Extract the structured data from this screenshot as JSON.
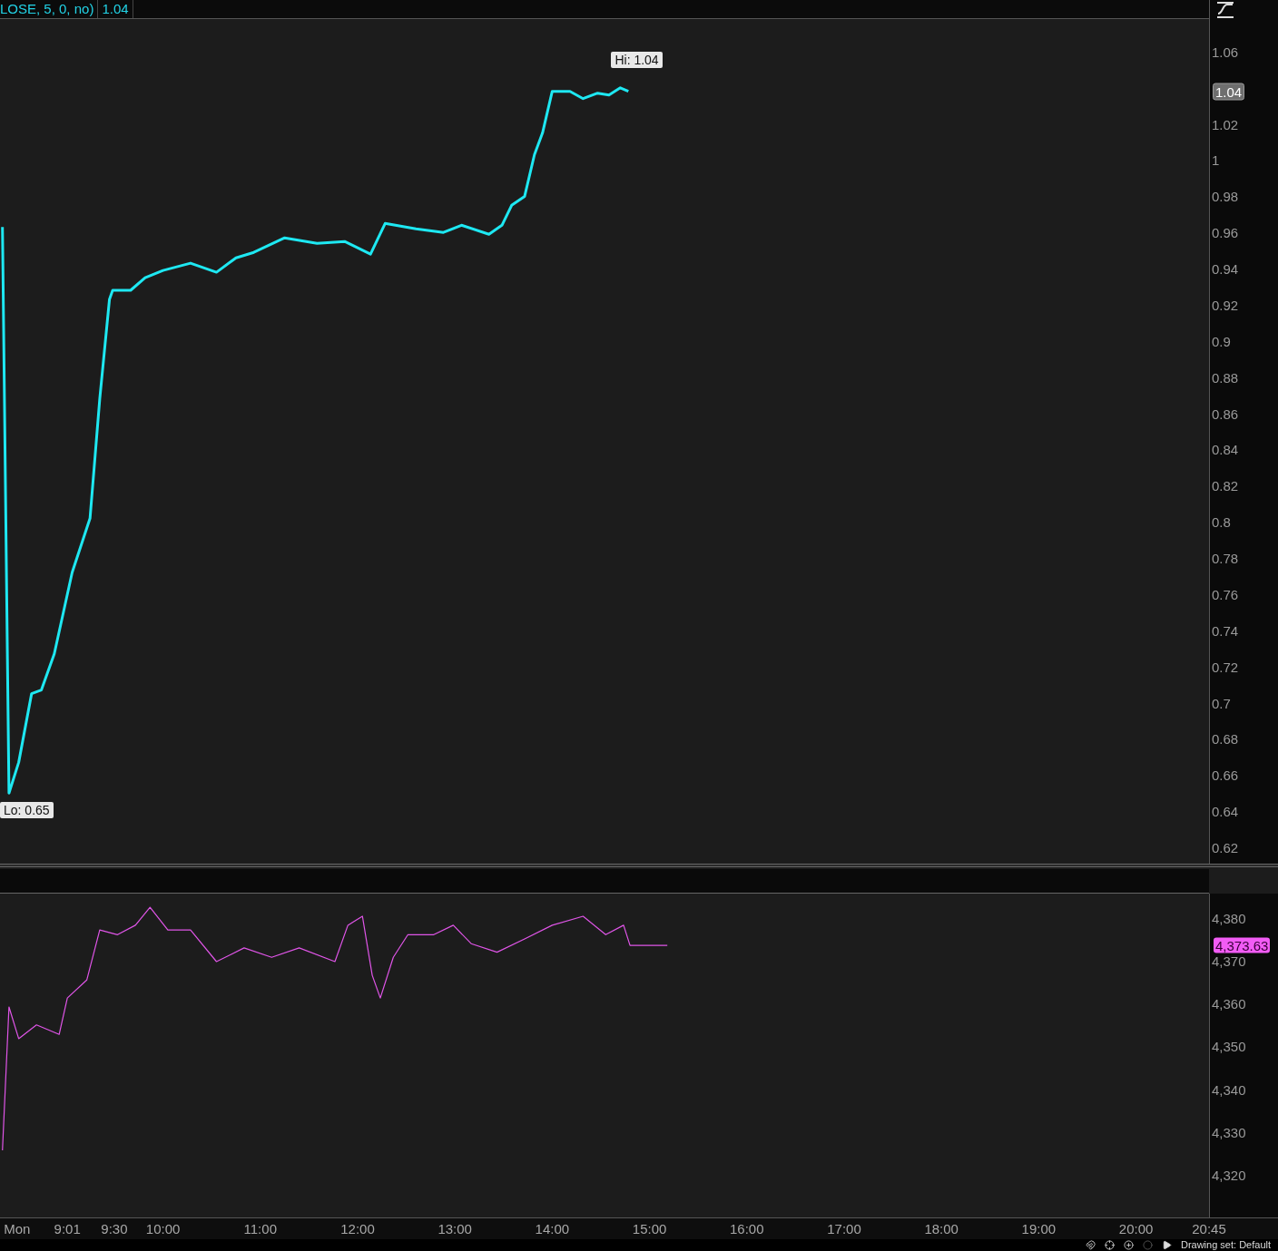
{
  "header": {
    "study_label": "LOSE, 5, 0, no)",
    "study_value": "1.04"
  },
  "price_chart": {
    "current_price": "1.04",
    "chart_data": {
      "type": "line",
      "x": [
        8.35,
        8.417,
        8.517,
        8.65,
        8.75,
        8.883,
        9.067,
        9.25,
        9.35,
        9.45,
        9.483,
        9.667,
        9.817,
        10,
        10.283,
        10.55,
        10.75,
        10.933,
        11.25,
        11.583,
        11.867,
        12.133,
        12.283,
        12.6,
        12.883,
        13.067,
        13.35,
        13.483,
        13.583,
        13.717,
        13.817,
        13.9,
        14,
        14.183,
        14.317,
        14.467,
        14.583,
        14.7,
        14.783
      ],
      "series": [
        {
          "color": "#1ee8f2",
          "values": [
            0.963,
            0.65,
            0.667,
            0.705,
            0.707,
            0.727,
            0.772,
            0.802,
            0.868,
            0.923,
            0.928,
            0.928,
            0.935,
            0.939,
            0.943,
            0.938,
            0.946,
            0.949,
            0.957,
            0.954,
            0.955,
            0.948,
            0.965,
            0.962,
            0.96,
            0.964,
            0.959,
            0.964,
            0.975,
            0.98,
            1.003,
            1.015,
            1.038,
            1.038,
            1.034,
            1.037,
            1.036,
            1.04,
            1.038
          ]
        }
      ],
      "xlim": [
        8.325,
        20.75
      ],
      "ylim": [
        0.611,
        1.078
      ],
      "yticks": [
        {
          "value": 1.06,
          "label": "1.06"
        },
        {
          "value": 1.02,
          "label": "1.02"
        },
        {
          "value": 1,
          "label": "1"
        },
        {
          "value": 0.98,
          "label": "0.98"
        },
        {
          "value": 0.96,
          "label": "0.96"
        },
        {
          "value": 0.94,
          "label": "0.94"
        },
        {
          "value": 0.92,
          "label": "0.92"
        },
        {
          "value": 0.9,
          "label": "0.9"
        },
        {
          "value": 0.88,
          "label": "0.88"
        },
        {
          "value": 0.86,
          "label": "0.86"
        },
        {
          "value": 0.84,
          "label": "0.84"
        },
        {
          "value": 0.82,
          "label": "0.82"
        },
        {
          "value": 0.8,
          "label": "0.8"
        },
        {
          "value": 0.78,
          "label": "0.78"
        },
        {
          "value": 0.76,
          "label": "0.76"
        },
        {
          "value": 0.74,
          "label": "0.74"
        },
        {
          "value": 0.72,
          "label": "0.72"
        },
        {
          "value": 0.7,
          "label": "0.7"
        },
        {
          "value": 0.68,
          "label": "0.68"
        },
        {
          "value": 0.66,
          "label": "0.66"
        },
        {
          "value": 0.64,
          "label": "0.64"
        },
        {
          "value": 0.62,
          "label": "0.62"
        }
      ],
      "annotations": [
        {
          "text": "Hi: 1.04",
          "x": 14.7,
          "y": 1.04
        },
        {
          "text": "Lo: 0.65",
          "x": 8.417,
          "y": 0.65
        }
      ]
    }
  },
  "index_chart": {
    "current_price": "4,373.63",
    "chart_data": {
      "type": "line",
      "x": [
        8.35,
        8.417,
        8.517,
        8.7,
        8.933,
        9.017,
        9.217,
        9.35,
        9.533,
        9.717,
        9.867,
        10.05,
        10.283,
        10.55,
        10.833,
        11.117,
        11.4,
        11.767,
        11.9,
        12.05,
        12.15,
        12.233,
        12.367,
        12.517,
        12.783,
        12.983,
        13.167,
        13.433,
        13.717,
        14,
        14.317,
        14.55,
        14.733,
        14.8,
        15.183
      ],
      "series": [
        {
          "color": "#e055e8",
          "values": [
            4325.7,
            4359.2,
            4351.8,
            4355,
            4352.8,
            4361.3,
            4365.5,
            4377.2,
            4376.1,
            4378.3,
            4382.5,
            4377.2,
            4377.2,
            4369.8,
            4373,
            4370.8,
            4373,
            4369.8,
            4378.3,
            4380.4,
            4366.6,
            4361.3,
            4370.8,
            4376.1,
            4376.1,
            4378.3,
            4374,
            4372,
            4375.1,
            4378.3,
            4380.4,
            4376.1,
            4378.3,
            4373.6,
            4373.6
          ]
        }
      ],
      "xlim": [
        8.325,
        20.75
      ],
      "ylim": [
        4310,
        4385.7
      ],
      "yticks": [
        {
          "value": 4380,
          "label": "4,380"
        },
        {
          "value": 4370,
          "label": "4,370"
        },
        {
          "value": 4360,
          "label": "4,360"
        },
        {
          "value": 4350,
          "label": "4,350"
        },
        {
          "value": 4340,
          "label": "4,340"
        },
        {
          "value": 4330,
          "label": "4,330"
        },
        {
          "value": 4320,
          "label": "4,320"
        }
      ],
      "xticks": [
        {
          "value": 8.5,
          "label": "Mon"
        },
        {
          "value": 9.017,
          "label": "9:01"
        },
        {
          "value": 9.5,
          "label": "9:30"
        },
        {
          "value": 10,
          "label": "10:00"
        },
        {
          "value": 11,
          "label": "11:00"
        },
        {
          "value": 12,
          "label": "12:00"
        },
        {
          "value": 13,
          "label": "13:00"
        },
        {
          "value": 14,
          "label": "14:00"
        },
        {
          "value": 15,
          "label": "15:00"
        },
        {
          "value": 16,
          "label": "16:00"
        },
        {
          "value": 17,
          "label": "17:00"
        },
        {
          "value": 18,
          "label": "18:00"
        },
        {
          "value": 19,
          "label": "19:00"
        },
        {
          "value": 20,
          "label": "20:00"
        },
        {
          "value": 20.75,
          "label": "20:45"
        }
      ]
    }
  },
  "footer": {
    "drawing_set": "Drawing set: Default"
  }
}
